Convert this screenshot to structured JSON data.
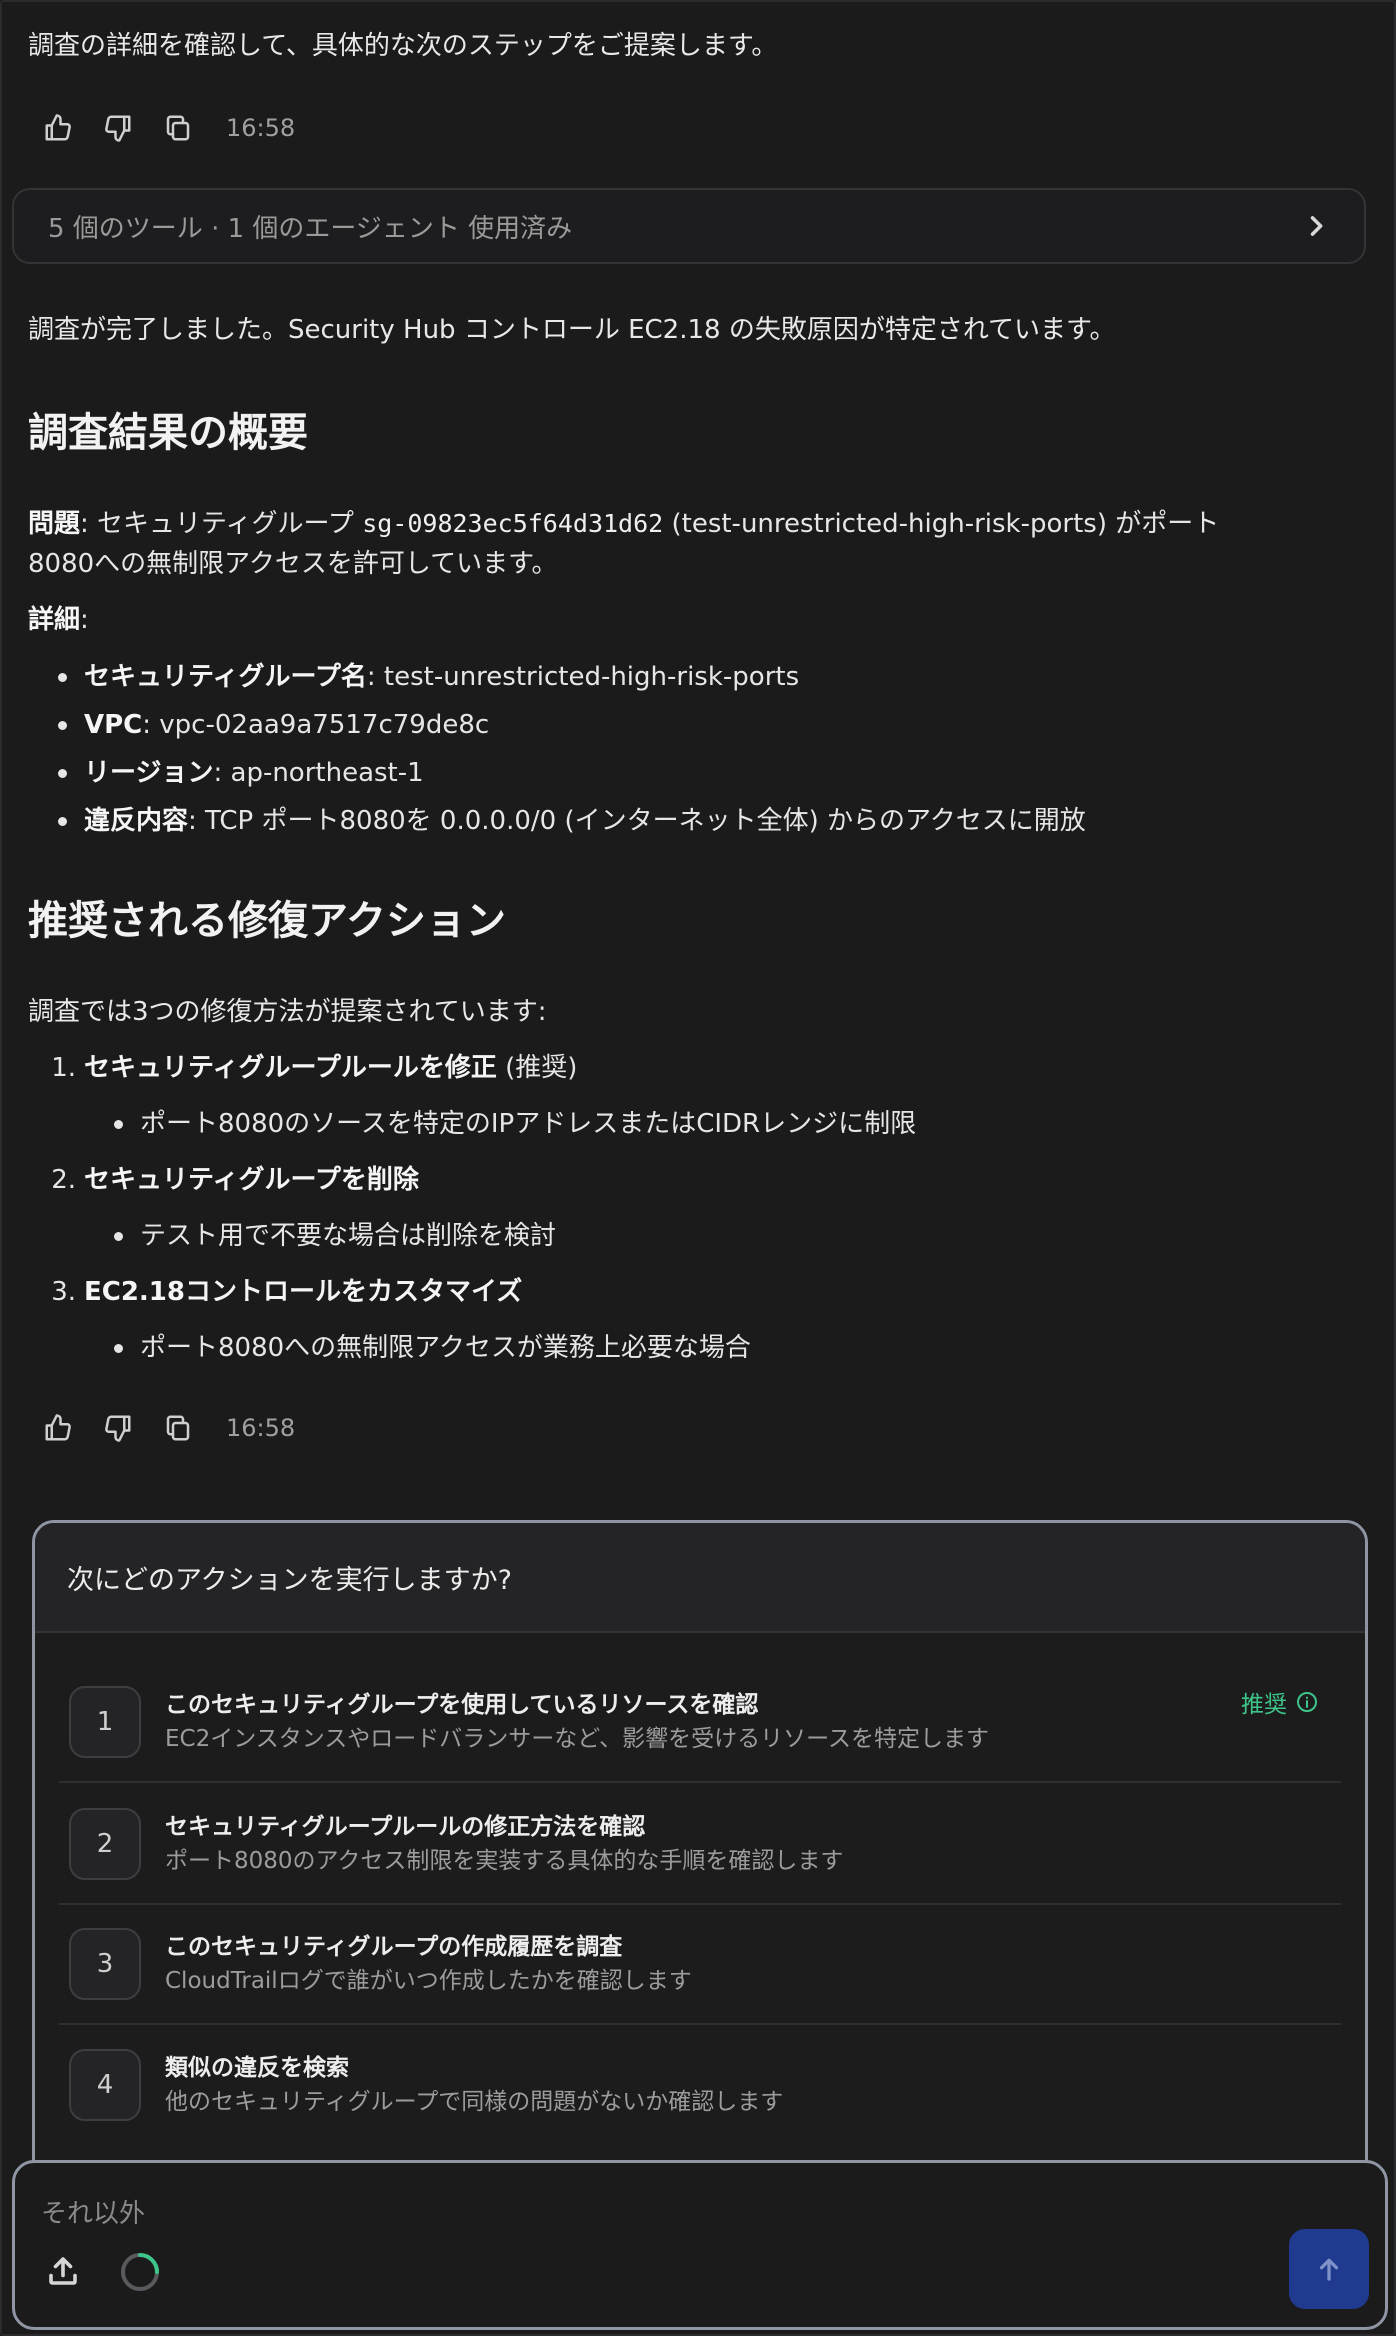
{
  "message1": {
    "text": "調査の詳細を確認して、具体的な次のステップをご提案します。",
    "time": "16:58"
  },
  "tools_bar": {
    "label": "5 個のツール · 1 個のエージェント 使用済み"
  },
  "message2": {
    "intro": "調査が完了しました。Security Hub コントロール EC2.18 の失敗原因が特定されています。",
    "summary_heading": "調査結果の概要",
    "problem_label": "問題",
    "problem_pre": ": セキュリティグループ ",
    "problem_code": "sg-09823ec5f64d31d62",
    "problem_post_line1": " (test-unrestricted-high-risk-ports) がポート",
    "problem_line2": "8080への無制限アクセスを許可しています。",
    "details_label": "詳細",
    "details_colon": ":",
    "details": [
      {
        "label": "セキュリティグループ名",
        "value": ": test-unrestricted-high-risk-ports"
      },
      {
        "label": "VPC",
        "value": ": vpc-02aa9a7517c79de8c"
      },
      {
        "label": "リージョン",
        "value": ": ap-northeast-1"
      },
      {
        "label": "違反内容",
        "value": ": TCP ポート8080を 0.0.0.0/0 (インターネット全体) からのアクセスに開放"
      }
    ],
    "remediation_heading": "推奨される修復アクション",
    "remediation_intro": "調査では3つの修復方法が提案されています:",
    "remediations": [
      {
        "num": "1.",
        "title": "セキュリティグループルールを修正",
        "suffix": " (推奨)",
        "sub": "ポート8080のソースを特定のIPアドレスまたはCIDRレンジに制限"
      },
      {
        "num": "2.",
        "title": "セキュリティグループを削除",
        "suffix": "",
        "sub": "テスト用で不要な場合は削除を検討"
      },
      {
        "num": "3.",
        "title": "EC2.18コントロールをカスタマイズ",
        "suffix": "",
        "sub": "ポート8080への無制限アクセスが業務上必要な場合"
      }
    ],
    "time": "16:58"
  },
  "action_panel": {
    "question": "次にどのアクションを実行しますか?",
    "recommended_label": "推奨",
    "options": [
      {
        "num": "1",
        "title": "このセキュリティグループを使用しているリソースを確認",
        "desc": "EC2インスタンスやロードバランサーなど、影響を受けるリソースを特定します"
      },
      {
        "num": "2",
        "title": "セキュリティグループルールの修正方法を確認",
        "desc": "ポート8080のアクセス制限を実装する具体的な手順を確認します"
      },
      {
        "num": "3",
        "title": "このセキュリティグループの作成履歴を調査",
        "desc": "CloudTrailログで誰がいつ作成したかを確認します"
      },
      {
        "num": "4",
        "title": "類似の違反を検索",
        "desc": "他のセキュリティグループで同様の問題がないか確認します"
      }
    ]
  },
  "composer": {
    "placeholder": "それ以外"
  },
  "colors": {
    "background": "#1b1b1c",
    "recommended": "#3ec58a",
    "send_button": "#1f3a8f",
    "panel_border": "#8f96a3"
  },
  "icons": [
    "thumbs-up-icon",
    "thumbs-down-icon",
    "copy-icon",
    "chevron-right-icon",
    "info-icon",
    "upload-icon",
    "loading-spinner-icon",
    "arrow-up-icon"
  ]
}
